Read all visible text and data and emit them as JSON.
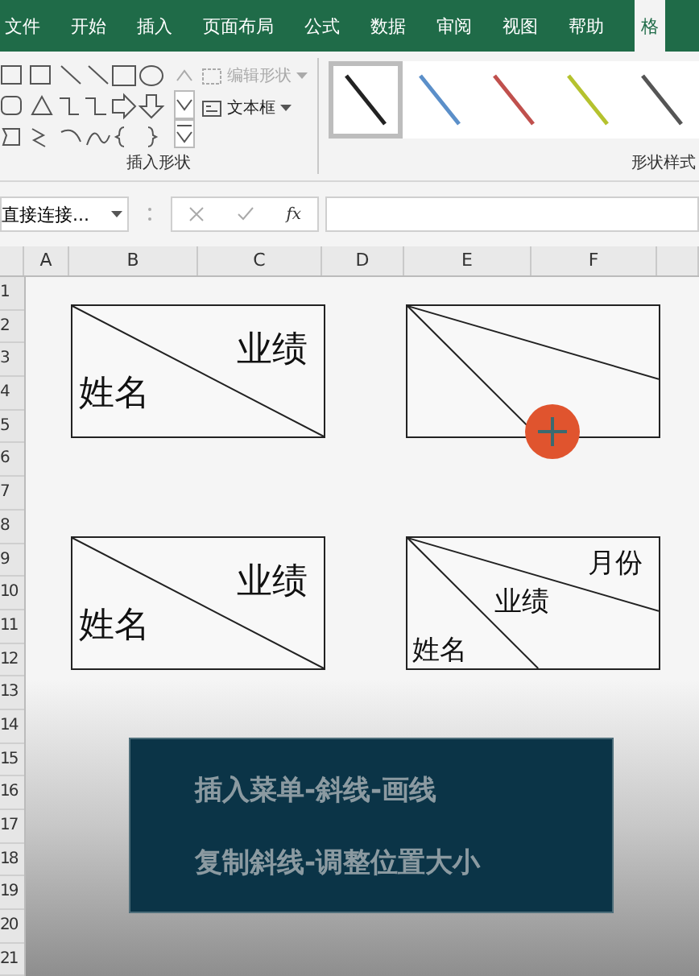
{
  "ribbon_tabs": [
    {
      "label": "文件",
      "selected": false
    },
    {
      "label": "开始",
      "selected": false
    },
    {
      "label": "插入",
      "selected": false
    },
    {
      "label": "页面布局",
      "selected": false
    },
    {
      "label": "公式",
      "selected": false
    },
    {
      "label": "数据",
      "selected": false
    },
    {
      "label": "审阅",
      "selected": false
    },
    {
      "label": "视图",
      "selected": false
    },
    {
      "label": "帮助",
      "selected": false
    },
    {
      "label": "格",
      "selected": true
    }
  ],
  "ribbon": {
    "edit_shape": {
      "label": "编辑形状",
      "disabled": true
    },
    "text_box": {
      "label": "文本框"
    },
    "groups": [
      {
        "label": "插入形状"
      },
      {
        "label": "形状样式"
      }
    ],
    "style_swatches": [
      {
        "color": "#222222",
        "selected": true
      },
      {
        "color": "#5b8fc9",
        "selected": false
      },
      {
        "color": "#c0504d",
        "selected": false
      },
      {
        "color": "#b5c22e",
        "selected": false
      },
      {
        "color": "#555555",
        "selected": false
      }
    ]
  },
  "formula_bar": {
    "name_box": "直接连接...",
    "function_label": "fx"
  },
  "columns": [
    "A",
    "B",
    "C",
    "D",
    "E",
    "F"
  ],
  "rows": [
    "1",
    "2",
    "3",
    "4",
    "5",
    "6",
    "7",
    "8",
    "9",
    "10",
    "11",
    "12",
    "13",
    "14",
    "15",
    "16",
    "17",
    "18",
    "19",
    "20",
    "21"
  ],
  "header_cells": [
    {
      "kind": "single",
      "cursor": false,
      "labels": [
        "业绩",
        "姓名"
      ]
    },
    {
      "kind": "double",
      "cursor": true
    },
    {
      "kind": "single",
      "cursor": false,
      "labels": [
        "业绩",
        "姓名"
      ]
    },
    {
      "kind": "double",
      "cursor": false,
      "labels": [
        "月份",
        "业绩",
        "姓名"
      ]
    }
  ],
  "caption": [
    "插入菜单-斜线-画线",
    "复制斜线-调整位置大小"
  ]
}
